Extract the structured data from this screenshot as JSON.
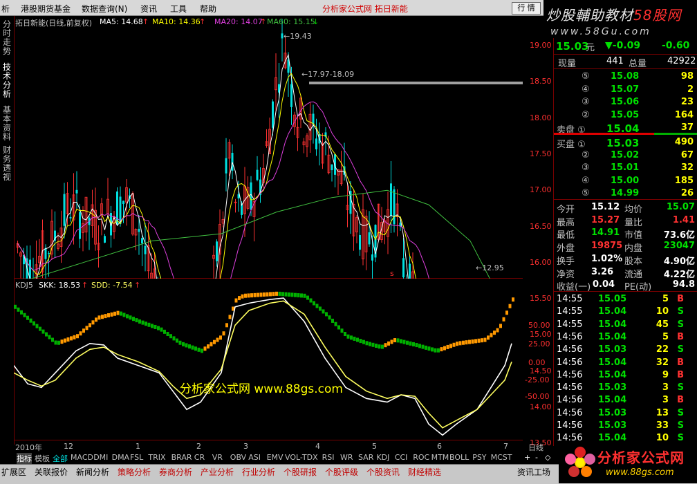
{
  "menu": {
    "items": [
      "析",
      "港股期货基金",
      "数据查询(N)",
      "资讯",
      "工具",
      "帮助"
    ],
    "title": "分析家公式网  拓日新能",
    "quote_btn": "行 情"
  },
  "watermark_top": {
    "line1a": "炒股輔助教材",
    "line1b": "58股网",
    "url": "www.58Gu.com"
  },
  "left_tabs": [
    "分时走势",
    "技术分析",
    "基本资料",
    "财务透视"
  ],
  "main_chart": {
    "stock_label": "拓日新能(日线,前复权)",
    "ma5": "MA5: 14.68",
    "ma10": "MA10: 14.36",
    "ma20": "MA20: 14.07",
    "ma60": "MA60: 15.15",
    "high_note": "19.43",
    "range_note": "17.97-18.09",
    "low_note": "12.95",
    "y_ticks": [
      "19.00",
      "18.50",
      "18.00",
      "17.50",
      "17.00",
      "16.50",
      "16.00",
      "15.50",
      "15.00",
      "14.50",
      "14.00",
      "13.50",
      "13.00"
    ]
  },
  "kdj_chart": {
    "label": "KDJ5",
    "skk": "SKK: 18.53",
    "sdd": "SDD: -7.54",
    "y_ticks": [
      "50.00",
      "25.00",
      "0.00",
      "-25.00",
      "-50.00"
    ],
    "watermark": "分析家公式网  www.88gs.com"
  },
  "date_axis": {
    "labels": [
      "2010年",
      "12",
      "1",
      "2",
      "3",
      "4",
      "5",
      "6",
      "7"
    ],
    "period": "日线"
  },
  "quote": {
    "price": "15.03",
    "unit": "元",
    "change": "▼-0.09",
    "pct": "-0.60",
    "now_vol_label": "现量",
    "now_vol": "441",
    "total_label": "总量",
    "total": "42922",
    "sell_levels": [
      {
        "lv": "⑤",
        "p": "15.08",
        "v": "98"
      },
      {
        "lv": "④",
        "p": "15.07",
        "v": "2"
      },
      {
        "lv": "③",
        "p": "15.06",
        "v": "23"
      },
      {
        "lv": "②",
        "p": "15.05",
        "v": "164"
      },
      {
        "lv": "卖盘 ①",
        "p": "15.04",
        "v": "37"
      }
    ],
    "buy_levels": [
      {
        "lv": "买盘 ①",
        "p": "15.03",
        "v": "490"
      },
      {
        "lv": "②",
        "p": "15.02",
        "v": "67"
      },
      {
        "lv": "③",
        "p": "15.01",
        "v": "32"
      },
      {
        "lv": "④",
        "p": "15.00",
        "v": "185"
      },
      {
        "lv": "⑤",
        "p": "14.99",
        "v": "26"
      }
    ],
    "stats": [
      {
        "a": "今开",
        "av": "15.12",
        "b": "均价",
        "bv": "15.07"
      },
      {
        "a": "最高",
        "av": "15.27",
        "b": "量比",
        "bv": "1.41"
      },
      {
        "a": "最低",
        "av": "14.91",
        "b": "市值",
        "bv": "73.6亿"
      },
      {
        "a": "外盘",
        "av": "19875",
        "b": "内盘",
        "bv": "23047"
      },
      {
        "a": "换手",
        "av": "1.02%",
        "b": "股本",
        "bv": "4.90亿"
      },
      {
        "a": "净资",
        "av": "3.26",
        "b": "流通",
        "bv": "4.22亿"
      },
      {
        "a": "收益(一)",
        "av": "0.04",
        "b": "PE(动)",
        "bv": "94.8"
      }
    ],
    "ticks": [
      {
        "t": "14:55",
        "p": "15.05",
        "v": "5",
        "s": "B"
      },
      {
        "t": "14:55",
        "p": "15.04",
        "v": "10",
        "s": "S"
      },
      {
        "t": "14:55",
        "p": "15.04",
        "v": "45",
        "s": "S"
      },
      {
        "t": "14:56",
        "p": "15.04",
        "v": "5",
        "s": "B"
      },
      {
        "t": "14:56",
        "p": "15.03",
        "v": "22",
        "s": "S"
      },
      {
        "t": "14:56",
        "p": "15.04",
        "v": "32",
        "s": "B"
      },
      {
        "t": "14:56",
        "p": "15.04",
        "v": "9",
        "s": "B"
      },
      {
        "t": "14:56",
        "p": "15.03",
        "v": "3",
        "s": "S"
      },
      {
        "t": "14:56",
        "p": "15.04",
        "v": "3",
        "s": "B"
      },
      {
        "t": "14:56",
        "p": "15.03",
        "v": "13",
        "s": "S"
      },
      {
        "t": "14:56",
        "p": "15.03",
        "v": "33",
        "s": "S"
      },
      {
        "t": "14:56",
        "p": "15.04",
        "v": "10",
        "s": "S"
      }
    ]
  },
  "indicator_bar": [
    "指标",
    "模板",
    "全部",
    "MACD",
    "DMI",
    "DMA",
    "FSL",
    "TRIX",
    "BRAR",
    "CR",
    "VR",
    "OBV",
    "ASI",
    "EMV",
    "VOL-TDX",
    "RSI",
    "WR",
    "SAR",
    "KDJ",
    "CCI",
    "ROC",
    "MTM",
    "BOLL",
    "PSY",
    "MCST"
  ],
  "zoom_buttons": [
    "+",
    "-",
    "◇"
  ],
  "bottom_tabs": [
    "扩展区",
    "关联报价",
    "新闻分析",
    "策略分析",
    "券商分析",
    "产业分析",
    "行业分析",
    "个股研报",
    "个股评级",
    "个股资讯",
    "财经精选",
    "资讯工场"
  ],
  "logo_bottom": {
    "text": "分析家公式网",
    "url": "www.88gs.com"
  },
  "colors": {
    "up": "#ff3232",
    "down": "#00e0e0",
    "green": "#00d000",
    "yellow": "#ffff00",
    "magenta": "#e040e0",
    "ma60": "#40c040",
    "orange": "#ff9900",
    "kdjgreen": "#00b000"
  }
}
